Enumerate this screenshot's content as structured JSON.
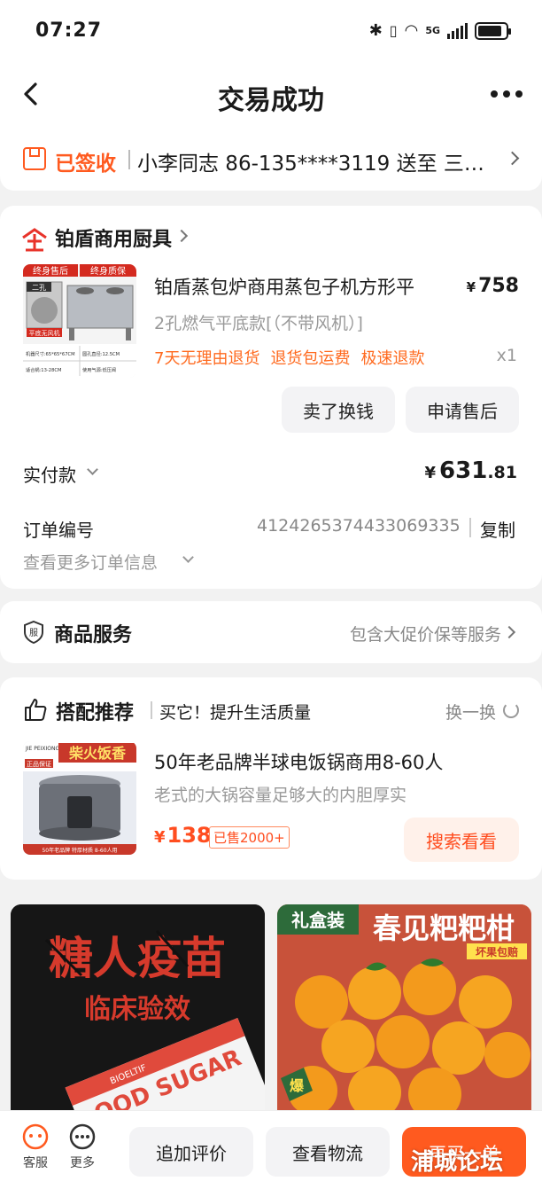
{
  "status_bar": {
    "time": "07:27",
    "network": "5G"
  },
  "nav": {
    "title": "交易成功"
  },
  "delivery": {
    "status": "已签收",
    "address": "小李同志  86-135****3119  送至  三…"
  },
  "shop": {
    "name": "铂盾商用厨具"
  },
  "product": {
    "image_text": {
      "badge_left": "终身售后",
      "badge_right": "终身质保",
      "hole": "二孔",
      "plate": "平底无风机",
      "spec1": "机器尺寸:65*65*67CM",
      "spec2": "圆孔直径:12.5CM",
      "spec3": "适合锅:13-28CM",
      "spec4": "使用气源:低压阀"
    },
    "title": "铂盾蒸包炉商用蒸包子机方形平",
    "price_currency": "¥",
    "price": "758",
    "sku": "2孔燃气平底款[（不带风机）]",
    "tags": [
      "7天无理由退货",
      "退货包运费",
      "极速退款"
    ],
    "quantity": "x1"
  },
  "actions": {
    "sell": "卖了换钱",
    "after_sale": "申请售后"
  },
  "payment": {
    "label": "实付款",
    "currency": "¥",
    "amount_int": "631",
    "amount_dec": ".81"
  },
  "order": {
    "label": "订单编号",
    "number": "4124265374433069335",
    "copy": "复制",
    "more": "查看更多订单信息"
  },
  "service": {
    "icon_text": "服",
    "label": "商品服务",
    "info": "包含大促价保等服务"
  },
  "recommend": {
    "title": "搭配推荐",
    "subtitle": "买它！提升生活质量",
    "change": "换一换",
    "image_text": {
      "brand": "JIE PEIXIONG",
      "banner": "柴火饭香",
      "tag": "正品保证",
      "bottom": "50年老品牌  特厚材质  8-60人用"
    },
    "item_title": "50年老品牌半球电饭锅商用8-60人",
    "item_desc": "老式的大锅容量足够大的内胆厚实",
    "price_currency": "¥",
    "price": "138",
    "sold": "已售2000+",
    "search_button": "搜索看看"
  },
  "feed": [
    {
      "title": "糖人疫苗",
      "subtitle": "临床验效",
      "box_text": "OOD SUGAR",
      "box_brand": "BIOELTIF"
    },
    {
      "tag": "礼盒装",
      "title": "春见粑粑柑",
      "ribbon": "坏果包赔",
      "burst": "爆"
    }
  ],
  "bottom_bar": {
    "service": "客服",
    "more": "更多",
    "review": "追加评价",
    "logistics": "查看物流",
    "again": "再买一单"
  },
  "watermark": "浦城论坛",
  "colors": {
    "accent": "#ff5a1f",
    "price": "#ff4d1f",
    "bg": "#f2f2f2"
  }
}
